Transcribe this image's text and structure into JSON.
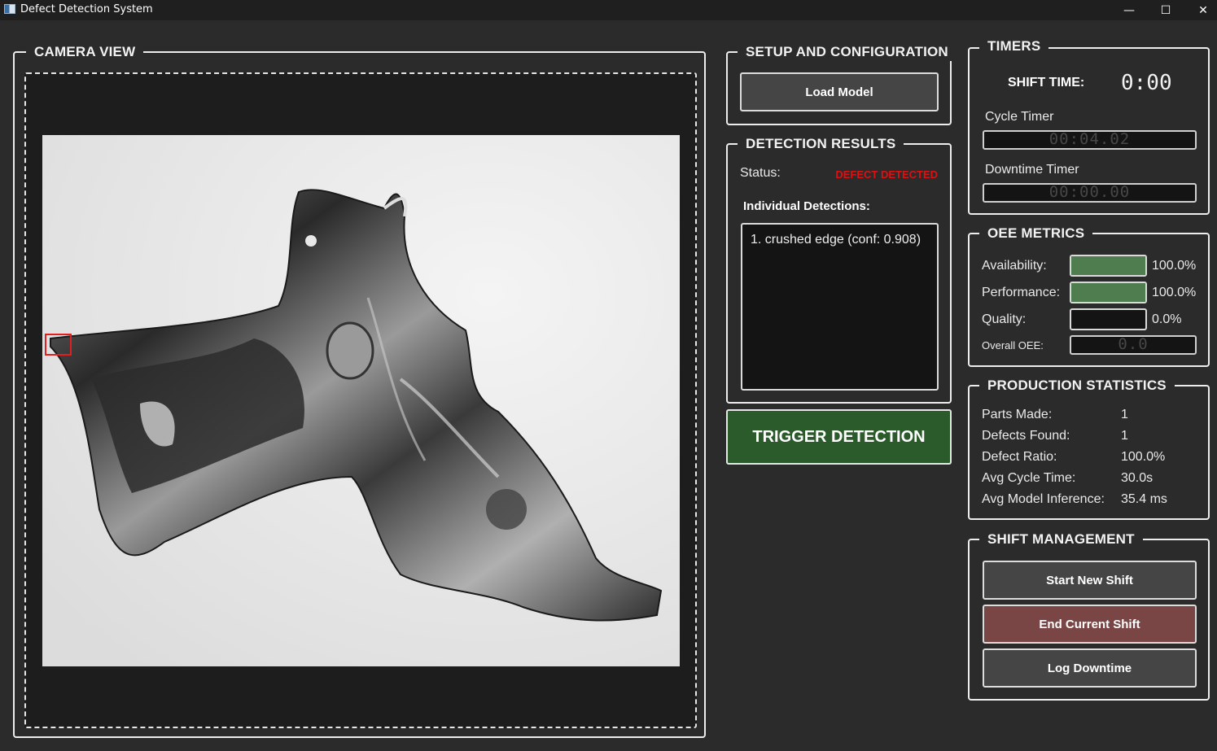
{
  "window": {
    "title": "Defect Detection System",
    "minimize": "—",
    "maximize": "☐",
    "close": "✕"
  },
  "camera": {
    "title": "CAMERA VIEW"
  },
  "setup": {
    "title": "SETUP AND CONFIGURATION",
    "load_model": "Load Model"
  },
  "results": {
    "title": "DETECTION RESULTS",
    "status_label": "Status:",
    "status_value": "DEFECT DETECTED",
    "detections_label": "Individual Detections:",
    "detections": [
      "1. crushed edge (conf: 0.908)"
    ]
  },
  "trigger": {
    "label": "TRIGGER DETECTION"
  },
  "timers": {
    "title": "TIMERS",
    "shift_label": "SHIFT TIME:",
    "shift_value": "0:00",
    "cycle_label": "Cycle Timer",
    "cycle_value": "00:04.02",
    "downtime_label": "Downtime Timer",
    "downtime_value": "00:00.00"
  },
  "oee": {
    "title": "OEE METRICS",
    "availability_label": "Availability:",
    "availability_value": "100.0%",
    "availability_level": 1.0,
    "performance_label": "Performance:",
    "performance_value": "100.0%",
    "performance_level": 1.0,
    "quality_label": "Quality:",
    "quality_value": "0.0%",
    "quality_level": 0.0,
    "overall_label": "Overall OEE:",
    "overall_value": "0.0"
  },
  "production": {
    "title": "PRODUCTION STATISTICS",
    "parts_made_label": "Parts Made:",
    "parts_made": "1",
    "defects_found_label": "Defects Found:",
    "defects_found": "1",
    "defect_ratio_label": "Defect Ratio:",
    "defect_ratio": "100.0%",
    "avg_cycle_label": "Avg Cycle Time:",
    "avg_cycle": "30.0s",
    "avg_inference_label": "Avg Model Inference:",
    "avg_inference": "35.4 ms"
  },
  "shift": {
    "title": "SHIFT MANAGEMENT",
    "start": "Start New Shift",
    "end": "End Current Shift",
    "log_downtime": "Log Downtime"
  },
  "colors": {
    "background": "#2b2b2b",
    "status_defect": "#e01010",
    "trigger_green": "#2b5a2b",
    "bar_green": "#4f7d50",
    "end_shift_red": "#7a4545"
  }
}
